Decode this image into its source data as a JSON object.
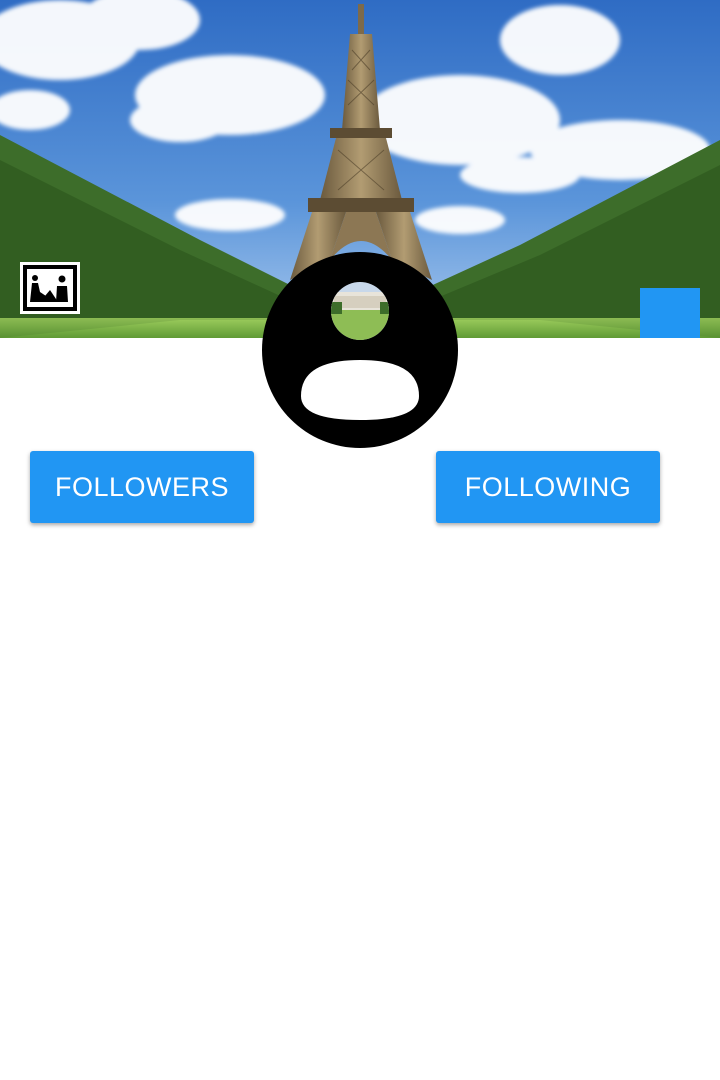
{
  "profile": {
    "cover": {
      "description_icon": "eiffel-tower-cover-photo",
      "sky_color": "#3f7fd0",
      "grass_color": "#7bb84a"
    },
    "change_cover_icon": "landscape-photo-icon",
    "avatar_icon": "account-circle-icon",
    "action_square_color": "#2196f3",
    "buttons": {
      "followers_label": "FOLLOWERS",
      "following_label": "FOLLOWING",
      "color": "#2196f3"
    }
  }
}
